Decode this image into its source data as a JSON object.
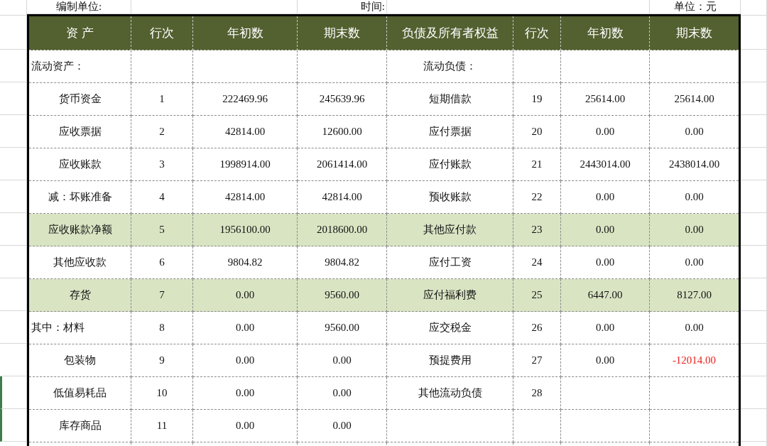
{
  "top_bar": {
    "unit_label": "编制单位:",
    "time_label": "时间:",
    "currency_label": "单位：元"
  },
  "columns": [
    "资 产",
    "行次",
    "年初数",
    "期末数",
    "负债及所有者权益",
    "行次",
    "年初数",
    "期末数"
  ],
  "rows": [
    {
      "highlighted": false,
      "left": {
        "kind": "section",
        "name": "流动资产："
      },
      "right": {
        "kind": "item",
        "name": "流动负债："
      }
    },
    {
      "highlighted": false,
      "left": {
        "kind": "item",
        "name": "货币资金",
        "no": "1",
        "start": "222469.96",
        "end": "245639.96"
      },
      "right": {
        "kind": "item",
        "name": "短期借款",
        "no": "19",
        "start": "25614.00",
        "end": "25614.00"
      }
    },
    {
      "highlighted": false,
      "left": {
        "kind": "item",
        "name": "应收票据",
        "no": "2",
        "start": "42814.00",
        "end": "12600.00"
      },
      "right": {
        "kind": "item",
        "name": "应付票据",
        "no": "20",
        "start": "0.00",
        "end": "0.00"
      }
    },
    {
      "highlighted": false,
      "left": {
        "kind": "item",
        "name": "应收账款",
        "no": "3",
        "start": "1998914.00",
        "end": "2061414.00"
      },
      "right": {
        "kind": "item",
        "name": "应付账款",
        "no": "21",
        "start": "2443014.00",
        "end": "2438014.00"
      }
    },
    {
      "highlighted": false,
      "left": {
        "kind": "item",
        "name": "减：坏账准备",
        "no": "4",
        "start": "42814.00",
        "end": "42814.00"
      },
      "right": {
        "kind": "item",
        "name": "预收账款",
        "no": "22",
        "start": "0.00",
        "end": "0.00"
      }
    },
    {
      "highlighted": true,
      "left": {
        "kind": "item",
        "name": "应收账款净额",
        "no": "5",
        "start": "1956100.00",
        "end": "2018600.00"
      },
      "right": {
        "kind": "item",
        "name": "其他应付款",
        "no": "23",
        "start": "0.00",
        "end": "0.00"
      }
    },
    {
      "highlighted": false,
      "left": {
        "kind": "item",
        "name": "其他应收款",
        "no": "6",
        "start": "9804.82",
        "end": "9804.82"
      },
      "right": {
        "kind": "item",
        "name": "应付工资",
        "no": "24",
        "start": "0.00",
        "end": "0.00"
      }
    },
    {
      "highlighted": true,
      "left": {
        "kind": "item",
        "name": "存货",
        "no": "7",
        "start": "0.00",
        "end": "9560.00"
      },
      "right": {
        "kind": "item",
        "name": "应付福利费",
        "no": "25",
        "start": "6447.00",
        "end": "8127.00"
      }
    },
    {
      "highlighted": false,
      "left": {
        "kind": "section",
        "name": "其中：材料",
        "no": "8",
        "start": "0.00",
        "end": "9560.00"
      },
      "right": {
        "kind": "item",
        "name": "应交税金",
        "no": "26",
        "start": "0.00",
        "end": "0.00"
      }
    },
    {
      "highlighted": false,
      "left": {
        "kind": "item",
        "name": "包装物",
        "no": "9",
        "start": "0.00",
        "end": "0.00"
      },
      "right": {
        "kind": "item",
        "name": "预提费用",
        "no": "27",
        "start": "0.00",
        "end": "-12014.00",
        "end_negative": true
      }
    },
    {
      "highlighted": false,
      "left": {
        "kind": "item",
        "name": "低值易耗品",
        "no": "10",
        "start": "0.00",
        "end": "0.00"
      },
      "right": {
        "kind": "item",
        "name": "其他流动负债",
        "no": "28"
      }
    },
    {
      "highlighted": false,
      "left": {
        "kind": "item",
        "name": "库存商品",
        "no": "11",
        "start": "0.00",
        "end": "0.00"
      },
      "right": {
        "kind": "item"
      }
    },
    {
      "highlighted": false,
      "left": {
        "kind": "item"
      },
      "right": {
        "kind": "item"
      }
    }
  ]
}
